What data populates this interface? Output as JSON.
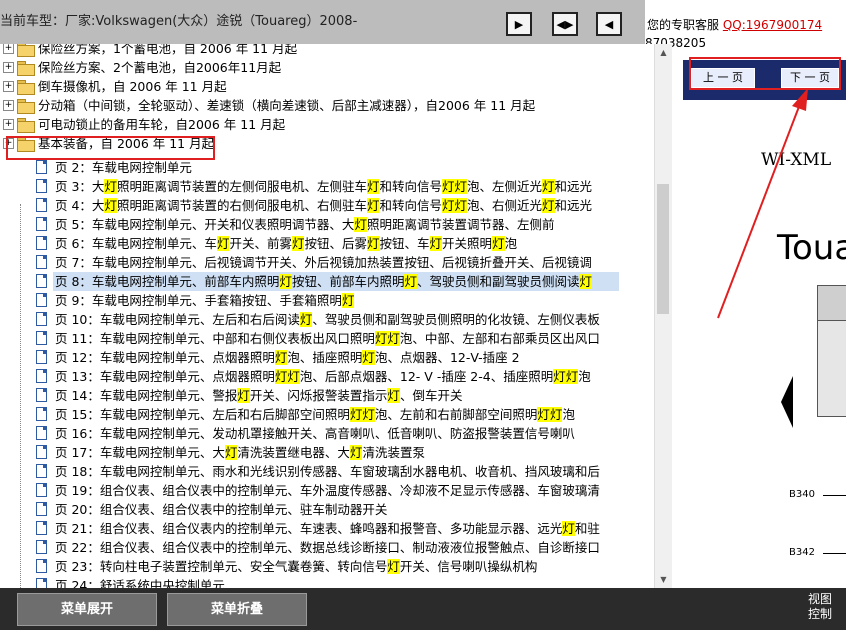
{
  "topbar": {
    "title": "当前车型：厂家:Volkswagen(大众）途锐（Touareg）2008-",
    "buttons": [
      "▶",
      "◀▶",
      "◀"
    ]
  },
  "support": {
    "prefix": "您的专职客服",
    "qq": "QQ:1967900174",
    "suffix": "87038205"
  },
  "tree": {
    "categories": [
      "保险丝方案，1个蓄电池，自 2006 年 11 月起",
      "保险丝方案、2个蓄电池，自2006年11月起",
      "倒车摄像机，自 2006 年 11 月起",
      "分动箱（中间锁，全轮驱动）、差速锁（横向差速锁、后部主减速器），自2006 年 11 月起",
      "可电动锁止的备用车轮，自2006 年 11 月起",
      "基本装备，自 2006 年 11 月起"
    ],
    "pages": [
      [
        [
          "页 2：车载电网控制单元",
          ""
        ]
      ],
      [
        [
          "页 3：大",
          ""
        ],
        [
          "灯",
          "hl"
        ],
        [
          "照明距离调节装置的左侧伺服电机、左侧驻车",
          ""
        ],
        [
          "灯",
          "hl"
        ],
        [
          "和转向信号",
          ""
        ],
        [
          "灯灯",
          "hl"
        ],
        [
          "泡、左侧近光",
          ""
        ],
        [
          "灯",
          "hl"
        ],
        [
          "和远光",
          ""
        ]
      ],
      [
        [
          "页 4：大",
          ""
        ],
        [
          "灯",
          "hl"
        ],
        [
          "照明距离调节装置的右侧伺服电机、右侧驻车",
          ""
        ],
        [
          "灯",
          "hl"
        ],
        [
          "和转向信号",
          ""
        ],
        [
          "灯灯",
          "hl"
        ],
        [
          "泡、右侧近光",
          ""
        ],
        [
          "灯",
          "hl"
        ],
        [
          "和远光",
          ""
        ]
      ],
      [
        [
          "页 5：车载电网控制单元、开关和仪表照明调节器、大",
          ""
        ],
        [
          "灯",
          "hl"
        ],
        [
          "照明距离调节装置调节器、左侧前",
          ""
        ]
      ],
      [
        [
          "页 6：车载电网控制单元、车",
          ""
        ],
        [
          "灯",
          "hl"
        ],
        [
          "开关、前雾",
          ""
        ],
        [
          "灯",
          "hl"
        ],
        [
          "按钮、后雾",
          ""
        ],
        [
          "灯",
          "hl"
        ],
        [
          "按钮、车",
          ""
        ],
        [
          "灯",
          "hl"
        ],
        [
          "开关照明",
          ""
        ],
        [
          "灯",
          "hl"
        ],
        [
          "泡",
          ""
        ]
      ],
      [
        [
          "页 7：车载电网控制单元、后视镜调节开关、外后视镜加热装置按钮、后视镜折叠开关、后视镜调",
          ""
        ]
      ],
      [
        [
          "页 8：车载电网控制单元、前部车内照明",
          ""
        ],
        [
          "灯",
          "hl"
        ],
        [
          "按钮、前部车内照明",
          ""
        ],
        [
          "灯",
          "hl"
        ],
        [
          "、驾驶员侧和副驾驶员侧阅读",
          ""
        ],
        [
          "灯",
          "hl"
        ]
      ],
      [
        [
          "页 9：车载电网控制单元、手套箱按钮、手套箱照明",
          ""
        ],
        [
          "灯",
          "hl"
        ]
      ],
      [
        [
          "页 10：车载电网控制单元、左后和右后阅读",
          ""
        ],
        [
          "灯",
          "hl"
        ],
        [
          "、驾驶员侧和副驾驶员侧照明的化妆镜、左侧仪表板",
          ""
        ]
      ],
      [
        [
          "页 11：车载电网控制单元、中部和右侧仪表板出风口照明",
          ""
        ],
        [
          "灯灯",
          "hl"
        ],
        [
          "泡、中部、左部和右部乘员区出风口",
          ""
        ]
      ],
      [
        [
          "页 12：车载电网控制单元、点烟器照明",
          ""
        ],
        [
          "灯",
          "hl"
        ],
        [
          "泡、插座照明",
          ""
        ],
        [
          "灯",
          "hl"
        ],
        [
          "泡、点烟器、12-V-插座 2",
          ""
        ]
      ],
      [
        [
          "页 13：车载电网控制单元、点烟器照明",
          ""
        ],
        [
          "灯灯",
          "hl"
        ],
        [
          "泡、后部点烟器、12- V -插座 2-4、插座照明",
          ""
        ],
        [
          "灯灯",
          "hl"
        ],
        [
          "泡",
          ""
        ]
      ],
      [
        [
          "页 14：车载电网控制单元、警报",
          ""
        ],
        [
          "灯",
          "hl"
        ],
        [
          "开关、闪烁报警装置指示",
          ""
        ],
        [
          "灯",
          "hl"
        ],
        [
          "、倒车开关",
          ""
        ]
      ],
      [
        [
          "页 15：车载电网控制单元、左后和右后脚部空间照明",
          ""
        ],
        [
          "灯灯",
          "hl"
        ],
        [
          "泡、左前和右前脚部空间照明",
          ""
        ],
        [
          "灯灯",
          "hl"
        ],
        [
          "泡",
          ""
        ]
      ],
      [
        [
          "页 16：车载电网控制单元、发动机罩接触开关、高音喇叭、低音喇叭、防盗报警装置信号喇叭",
          ""
        ]
      ],
      [
        [
          "页 17：车载电网控制单元、大",
          ""
        ],
        [
          "灯",
          "hl"
        ],
        [
          "清洗装置继电器、大",
          ""
        ],
        [
          "灯",
          "hl"
        ],
        [
          "清洗装置泵",
          ""
        ]
      ],
      [
        [
          "页 18：车载电网控制单元、雨水和光线识别传感器、车窗玻璃刮水器电机、收音机、挡风玻璃和后",
          ""
        ]
      ],
      [
        [
          "页 19：组合仪表、组合仪表中的控制单元、车外温度传感器、冷却液不足显示传感器、车窗玻璃清",
          ""
        ]
      ],
      [
        [
          "页 20：组合仪表、组合仪表中的控制单元、驻车制动器开关",
          ""
        ]
      ],
      [
        [
          "页 21：组合仪表、组合仪表内的控制单元、车速表、蜂鸣器和报警音、多功能显示器、远光",
          ""
        ],
        [
          "灯",
          "hl"
        ],
        [
          "和驻",
          ""
        ]
      ],
      [
        [
          "页 22：组合仪表、组合仪表中的控制单元、数据总线诊断接口、制动液液位报警触点、自诊断接口",
          ""
        ]
      ],
      [
        [
          "页 23：转向柱电子装置控制单元、安全气囊卷簧、转向信号",
          ""
        ],
        [
          "灯",
          "hl"
        ],
        [
          "开关、信号喇叭操纵机构",
          ""
        ]
      ],
      [
        [
          "页 24：舒适系统中央控制单元",
          ""
        ]
      ]
    ]
  },
  "doc": {
    "prev_label": "上 一 页",
    "next_label": "下 一 页",
    "wi_text": "WI-XML",
    "title_fragment": "Toua",
    "b340": "B340",
    "b342": "B342"
  },
  "bottom": {
    "expand_label": "菜单展开",
    "collapse_label": "菜单折叠",
    "view_label": "视图",
    "control_label": "控制"
  },
  "colors": {
    "highlight": "#ffff00",
    "annotation": "#e02020",
    "doc_nav_bg": "#1b2a6b"
  }
}
